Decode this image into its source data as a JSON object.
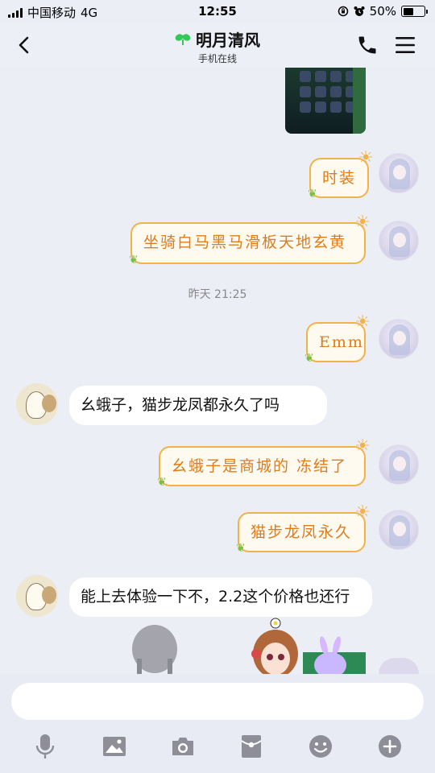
{
  "status_bar": {
    "carrier": "中国移动",
    "network": "4G",
    "time": "12:55",
    "battery": "50%",
    "battery_level": 0.5
  },
  "header": {
    "title": "明月清风",
    "subtitle": "手机在线"
  },
  "messages": [
    {
      "side": "right",
      "text": "时装"
    },
    {
      "side": "right",
      "text": "坐骑白马黑马滑板天地玄黄"
    },
    {
      "type": "timestamp",
      "text": "昨天 21:25"
    },
    {
      "side": "right",
      "text": "Emm"
    },
    {
      "side": "left",
      "text": "幺蛾子，猫步龙凤都永久了吗"
    },
    {
      "side": "right",
      "text": "幺蛾子是商城的 冻结了"
    },
    {
      "side": "right",
      "text": "猫步龙凤永久"
    },
    {
      "side": "left",
      "text": "能上去体验一下不，2.2这个价格也还行"
    }
  ],
  "input": {
    "placeholder": ""
  },
  "toolbar": {
    "icons": [
      "microphone-icon",
      "image-icon",
      "camera-icon",
      "red-packet-icon",
      "emoji-icon",
      "plus-icon"
    ]
  },
  "colors": {
    "accent_orange": "#e07b1a",
    "bubble_border": "#f2b24a",
    "online_leaf": "#34c759",
    "icon_gray": "#8e8e99"
  }
}
